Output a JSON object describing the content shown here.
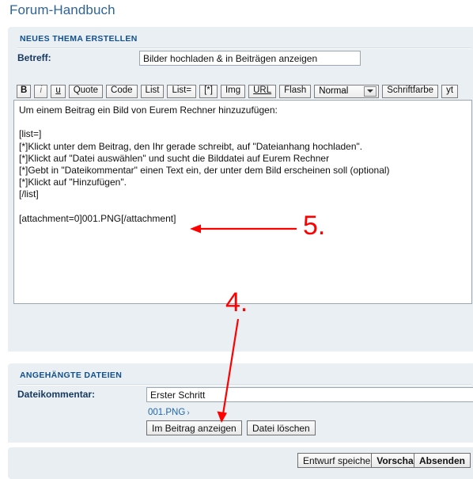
{
  "page": {
    "title": "Forum-Handbuch"
  },
  "topic_panel": {
    "header": "NEUES THEMA ERSTELLEN",
    "subject": {
      "label": "Betreff:",
      "value": "Bilder hochladen & in Beiträgen anzeigen"
    },
    "toolbar": {
      "bold": "B",
      "italic": "i",
      "underline": "u",
      "quote": "Quote",
      "code": "Code",
      "list": "List",
      "list_eq": "List=",
      "list_item": "[*]",
      "img": "Img",
      "url": "URL",
      "flash": "Flash",
      "font_size_selected": "Normal",
      "font_color": "Schriftfarbe",
      "yt": "yt"
    },
    "message": "Um einem Beitrag ein Bild von Eurem Rechner hinzuzufügen:\n\n[list=]\n[*]Klickt unter dem Beitrag, den Ihr gerade schreibt, auf \"Dateianhang hochladen\".\n[*]Klickt auf \"Datei auswählen\" und sucht die Bilddatei auf Eurem Rechner\n[*]Gebt in \"Dateikommentar\" einen Text ein, der unter dem Bild erscheinen soll (optional)\n[*]Klickt auf \"Hinzufügen\".\n[/list]\n\n[attachment=0]001.PNG[/attachment]"
  },
  "files_panel": {
    "header": "ANGEHÄNGTE DATEIEN",
    "comment": {
      "label": "Dateikommentar:",
      "value": "Erster Schritt"
    },
    "attachment": {
      "filename": "001.PNG",
      "chevron": "›"
    },
    "show_in_post_label": "Im Beitrag anzeigen",
    "delete_file_label": "Datei löschen"
  },
  "actions_panel": {
    "save_draft_label": "Entwurf speichern",
    "preview_label": "Vorschau",
    "submit_label": "Absenden"
  },
  "annotations": {
    "step5": "5.",
    "step4": "4.",
    "color": "#ff0000"
  },
  "colors": {
    "title_blue": "#2f6496",
    "header_blue": "#10508f",
    "label_navy": "#15385e",
    "panel_bg": "#eaeff3",
    "link_blue": "#1f66a8",
    "annotation_red": "#ff0000"
  }
}
